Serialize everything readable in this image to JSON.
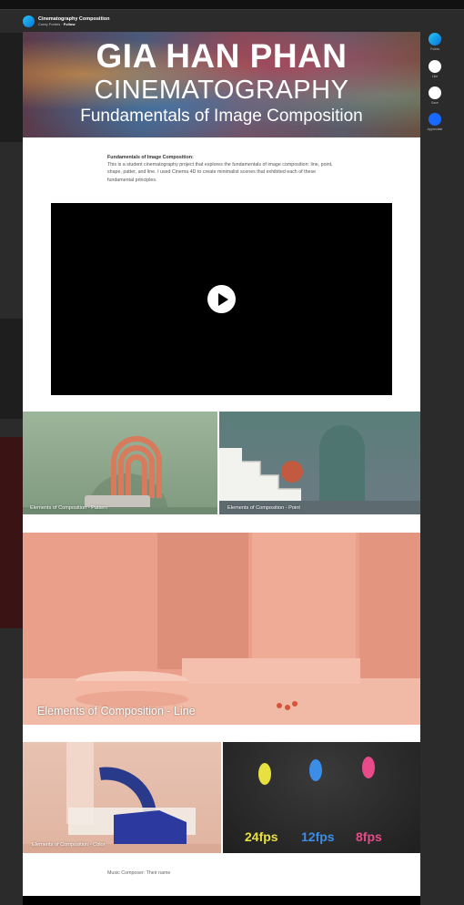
{
  "project": {
    "title": "Cinematography Composition",
    "owner": "Corey Forbes",
    "follow": "Follow"
  },
  "hero": {
    "line1": "GIA HAN PHAN",
    "line2": "CINEMATOGRAPHY",
    "line3": "Fundamentals of Image Composition"
  },
  "description": {
    "title": "Fundamentals of Image Composition:",
    "body": "This is a student cinematography project that explores the fundamentals of image composition: line, point, shape, patter, and line. I used Cinema 4D to create minimalist scenes that exhibited each of these fundamental principles."
  },
  "tiles": {
    "pattern": "Elements of Composition - Pattern",
    "point": "Elements of Composition - Point",
    "line": "Elements of Composition - Line",
    "color": "Elements of Composition - Color"
  },
  "fps": [
    "24fps",
    "12fps",
    "8fps"
  ],
  "footer": "Music Composer: Their name",
  "sidebar": [
    "Follow",
    "Like",
    "Save",
    "Appreciate"
  ],
  "colors": {
    "accent": "#1769ff",
    "fps_yellow": "#e8e040",
    "fps_blue": "#3a8ee8",
    "fps_pink": "#e84a8a"
  }
}
